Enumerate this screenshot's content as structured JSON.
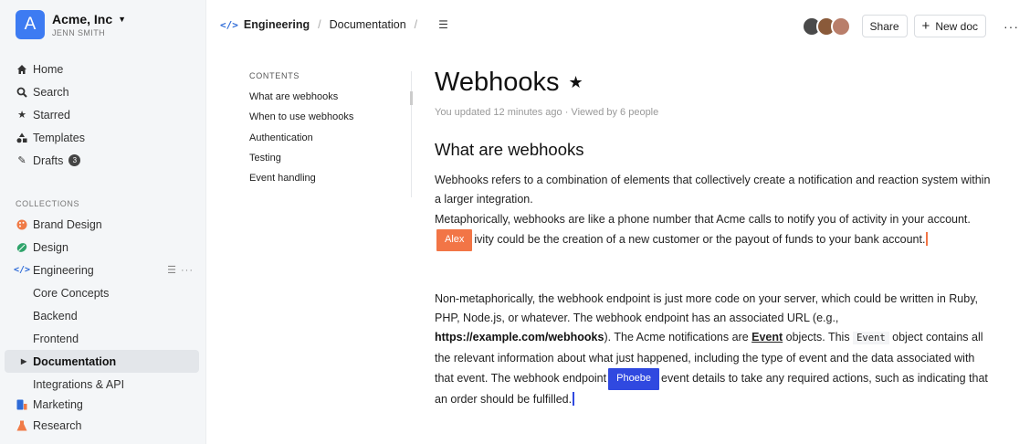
{
  "team": {
    "logo_letter": "A",
    "name": "Acme, Inc",
    "user": "JENN SMITH"
  },
  "nav": [
    {
      "name": "home",
      "label": "Home",
      "icon": "home-icon"
    },
    {
      "name": "search",
      "label": "Search",
      "icon": "search-icon"
    },
    {
      "name": "starred",
      "label": "Starred",
      "icon": "star-icon"
    },
    {
      "name": "templates",
      "label": "Templates",
      "icon": "shapes-icon"
    },
    {
      "name": "drafts",
      "label": "Drafts",
      "icon": "pencil-icon",
      "badge": "3"
    }
  ],
  "collections": {
    "heading": "COLLECTIONS",
    "items": [
      {
        "label": "Brand Design",
        "color": "#f07b47"
      },
      {
        "label": "Design",
        "color": "#2ea36a"
      },
      {
        "label": "Engineering",
        "color": "#2e6bd7"
      },
      {
        "label": "Core Concepts"
      },
      {
        "label": "Backend"
      },
      {
        "label": "Frontend"
      },
      {
        "label": "Documentation"
      },
      {
        "label": "Integrations & API"
      },
      {
        "label": "Marketing",
        "color": "#2e6bd7"
      },
      {
        "label": "Research",
        "color": "#f07b47"
      }
    ]
  },
  "breadcrumb": {
    "collection": "Engineering",
    "document": "Documentation"
  },
  "header": {
    "share_label": "Share",
    "new_doc_label": "New doc"
  },
  "toc": {
    "heading": "CONTENTS",
    "items": [
      "What are webhooks",
      "When to use webhooks",
      "Authentication",
      "Testing",
      "Event handling"
    ]
  },
  "doc": {
    "title": "Webhooks",
    "meta": "You updated 12 minutes ago · Viewed by 6 people",
    "section_title": "What are webhooks",
    "p1_line1": "Webhooks refers to a combination of elements that collectively create a notification and reaction system within a larger integration.",
    "p1_line2a": "Metaphorically, webhooks are like a phone number that Acme calls to notify you of activity in your account.",
    "p1_line2b": "ivity could be the creation of a new customer or the payout of funds to your bank account.",
    "p2a": "Non-metaphorically, the webhook endpoint is just more code on your server, which could be written in Ruby, PHP, Node.js, or whatever. The webhook endpoint has an associated URL (e.g., ",
    "p2_url": "https://example.com/webhooks",
    "p2b": "). The Acme notifications are ",
    "p2_event": "Event",
    "p2c": " objects. This ",
    "p2_code": "Event",
    "p2d": " object contains all the relevant information about what just happened, including the type of event and the data associated with that event. The webhook endpoint",
    "p2e": "event details to take any required actions, such as indicating that an order should be fulfilled."
  },
  "cursors": {
    "alex": {
      "name": "Alex",
      "color": "#f27546"
    },
    "phoebe": {
      "name": "Phoebe",
      "color": "#3049e0"
    }
  }
}
